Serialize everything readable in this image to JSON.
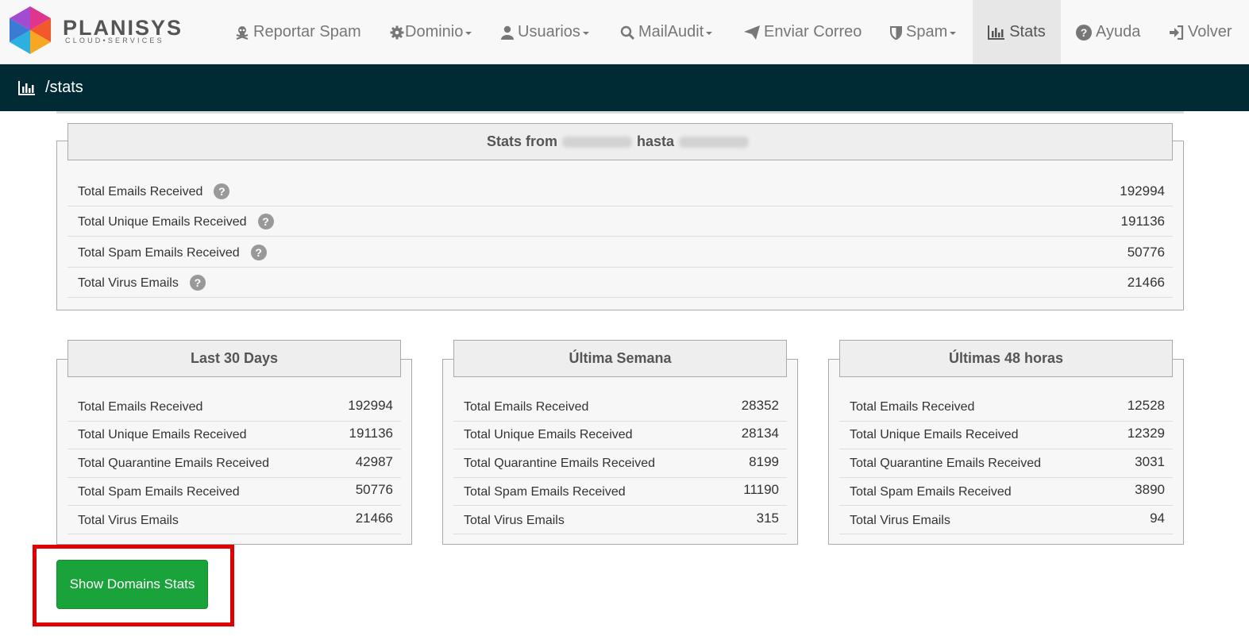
{
  "brand": {
    "name": "PLANISYS",
    "tagline": "CLOUD•SERVICES"
  },
  "nav": {
    "reportar_spam": "Reportar Spam",
    "dominio": "Dominio",
    "usuarios": "Usuarios",
    "mailaudit": "MailAudit",
    "enviar_correo": "Enviar Correo",
    "spam": "Spam",
    "stats": "Stats",
    "ayuda": "Ayuda",
    "volver": "Volver"
  },
  "breadcrumb": {
    "path": "/stats"
  },
  "overall": {
    "title_from": "Stats from",
    "title_to": "hasta",
    "rows": [
      {
        "label": "Total Emails Received",
        "value": "192994"
      },
      {
        "label": "Total Unique Emails Received",
        "value": "191136"
      },
      {
        "label": "Total Spam Emails Received",
        "value": "50776"
      },
      {
        "label": "Total Virus Emails",
        "value": "21466"
      }
    ],
    "help_glyph": "?"
  },
  "panels": [
    {
      "title": "Last 30 Days",
      "rows": [
        {
          "label": "Total Emails Received",
          "value": "192994"
        },
        {
          "label": "Total Unique Emails Received",
          "value": "191136"
        },
        {
          "label": "Total Quarantine Emails Received",
          "value": "42987"
        },
        {
          "label": "Total Spam Emails Received",
          "value": "50776"
        },
        {
          "label": "Total Virus Emails",
          "value": "21466"
        }
      ]
    },
    {
      "title": "Última Semana",
      "rows": [
        {
          "label": "Total Emails Received",
          "value": "28352"
        },
        {
          "label": "Total Unique Emails Received",
          "value": "28134"
        },
        {
          "label": "Total Quarantine Emails Received",
          "value": "8199"
        },
        {
          "label": "Total Spam Emails Received",
          "value": "11190"
        },
        {
          "label": "Total Virus Emails",
          "value": "315"
        }
      ]
    },
    {
      "title": "Últimas 48 horas",
      "rows": [
        {
          "label": "Total Emails Received",
          "value": "12528"
        },
        {
          "label": "Total Unique Emails Received",
          "value": "12329"
        },
        {
          "label": "Total Quarantine Emails Received",
          "value": "3031"
        },
        {
          "label": "Total Spam Emails Received",
          "value": "3890"
        },
        {
          "label": "Total Virus Emails",
          "value": "94"
        }
      ]
    }
  ],
  "actions": {
    "show_domains_stats": "Show Domains Stats"
  },
  "colors": {
    "navbar_bg": "#f8f8f8",
    "subheader_bg": "#002b35",
    "button_green": "#1aa33a",
    "highlight_red": "#e00000"
  }
}
